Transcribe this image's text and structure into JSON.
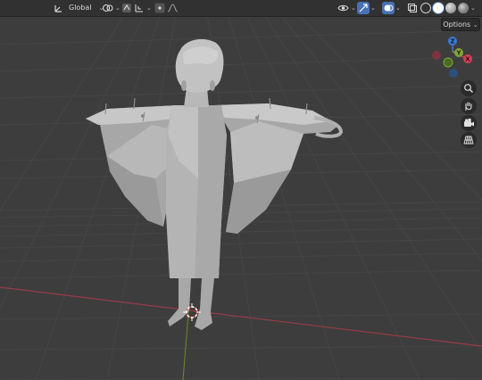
{
  "header": {
    "transform_orientation": "Global",
    "options_label": "Options"
  },
  "gizmo": {
    "z_label": "Z",
    "y_label": "Y",
    "x_label": "X"
  },
  "colors": {
    "background": "#3d3d3d",
    "grid": "#4a4a4a",
    "x_axis": "#9a3b46",
    "y_axis": "#6d8c2a",
    "model": "#b9b9b9",
    "active_blue": "#4772b3"
  },
  "icons": {
    "orientation": "transform-orientation-icon",
    "pivot": "pivot-point-icon",
    "snap": "snap-icon",
    "proportional": "proportional-editing-icon",
    "falloff": "falloff-curve-icon",
    "visibility": "eye-icon",
    "gizmos": "gizmo-icon",
    "overlays": "overlay-icon",
    "xray": "xray-icon",
    "wireframe": "wireframe-shading-icon",
    "solid": "solid-shading-icon",
    "material": "material-shading-icon",
    "rendered": "rendered-shading-icon",
    "zoom": "zoom-icon",
    "hand": "pan-icon",
    "camera": "camera-icon",
    "grid": "perspective-grid-icon"
  }
}
